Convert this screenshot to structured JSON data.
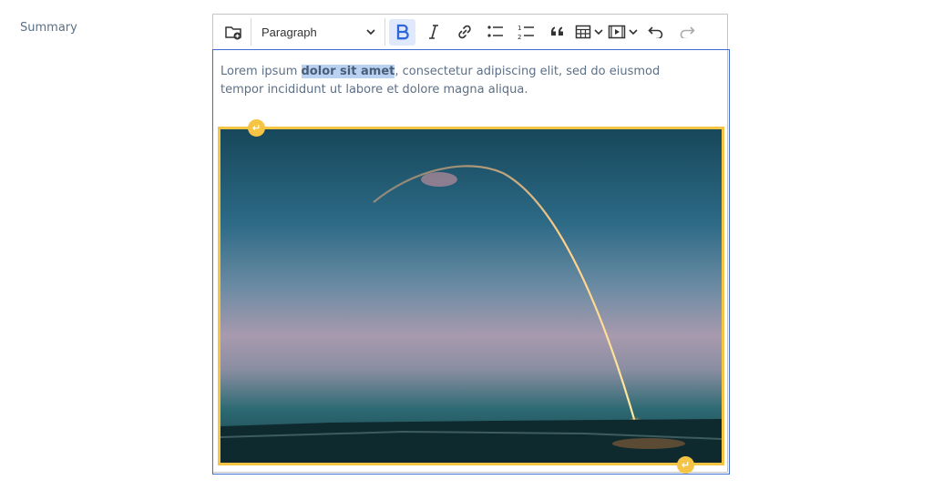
{
  "field": {
    "label": "Summary"
  },
  "toolbar": {
    "heading_select": "Paragraph",
    "buttons": [
      {
        "name": "insert-media-folder",
        "icon": "folder-add-icon"
      },
      {
        "name": "bold",
        "icon": "bold-icon",
        "active": true
      },
      {
        "name": "italic",
        "icon": "italic-icon"
      },
      {
        "name": "link",
        "icon": "link-icon"
      },
      {
        "name": "bulleted-list",
        "icon": "bulleted-list-icon"
      },
      {
        "name": "numbered-list",
        "icon": "numbered-list-icon"
      },
      {
        "name": "block-quote",
        "icon": "quote-icon"
      },
      {
        "name": "insert-table",
        "icon": "table-icon",
        "dropdown": true
      },
      {
        "name": "insert-media",
        "icon": "media-icon",
        "dropdown": true
      },
      {
        "name": "undo",
        "icon": "undo-icon"
      },
      {
        "name": "redo",
        "icon": "redo-icon",
        "disabled": true
      }
    ]
  },
  "content": {
    "text_before": "Lorem ipsum ",
    "text_bold_selected": "dolor sit amet",
    "text_after": ", consectetur adipiscing elit, sed do eiusmod tempor incididunt ut labore et dolore magna aliqua.",
    "image": {
      "subject": "rocket launch trail arcing over coastline at dusk",
      "selected": true
    }
  },
  "colors": {
    "accent": "#3e6bd4",
    "selection": "#b9d2f1",
    "widget_outline": "#f6c445",
    "text": "#5d6f86"
  }
}
